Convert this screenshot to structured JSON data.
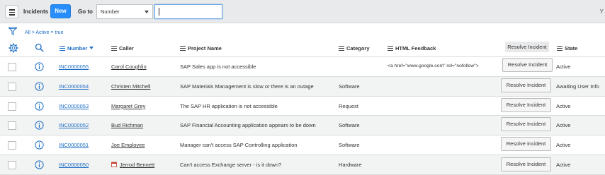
{
  "header": {
    "title": "Incidents",
    "new_label": "New",
    "goto_label": "Go to",
    "goto_select_value": "Number",
    "goto_input_value": "",
    "right_glyph": "Y"
  },
  "breadcrumb": {
    "text": "All > Active = true"
  },
  "columns": {
    "number": "Number",
    "caller": "Caller",
    "project_name": "Project Name",
    "category": "Category",
    "html_feedback": "HTML Feedback",
    "resolve": "Resolve Incident",
    "state": "State"
  },
  "rows": [
    {
      "number": "INC0000055",
      "caller": "Carol Coughlin",
      "project_name": "SAP Sales app is not accessible",
      "category": "",
      "html_feedback": "<a href=\"www.google.com\" rel=\"nofollow\">",
      "resolve_label": "Resolve Incident",
      "state": "Active"
    },
    {
      "number": "INC0000054",
      "caller": "Christen Mitchell",
      "project_name": "SAP Materials Management is slow or there is an outage",
      "category": "Software",
      "html_feedback": "",
      "resolve_label": "Resolve Incident",
      "state": "Awaiting User Info"
    },
    {
      "number": "INC0000053",
      "caller": "Margaret Grey",
      "project_name": "The SAP HR application is not accessible",
      "category": "Request",
      "html_feedback": "",
      "resolve_label": "Resolve Incident",
      "state": "Active"
    },
    {
      "number": "INC0000052",
      "caller": "Bud Richman",
      "project_name": "SAP Financial Accounting application appears to be down",
      "category": "Software",
      "html_feedback": "",
      "resolve_label": "Resolve Incident",
      "state": "Active"
    },
    {
      "number": "INC0000051",
      "caller": "Joe Employee",
      "project_name": "Manager can't access SAP Controlling application",
      "category": "Software",
      "html_feedback": "",
      "resolve_label": "Resolve Incident",
      "state": "Active"
    },
    {
      "number": "INC0000050",
      "caller": "Jerrod Bennett",
      "project_name": "Can't access Exchange server - is it down?",
      "category": "Hardware",
      "html_feedback": "",
      "resolve_label": "Resolve Incident",
      "state": "Active"
    }
  ],
  "icons": {
    "menu": "hamburger-icon",
    "filter": "funnel-icon",
    "settings": "gear-icon",
    "search": "search-icon",
    "info": "info-icon",
    "calendar": "calendar-icon"
  },
  "colors": {
    "accent": "#278efc",
    "link": "#1f6fc6",
    "header_bg": "#e8eaeb",
    "row_alt": "#f2f3f3"
  }
}
